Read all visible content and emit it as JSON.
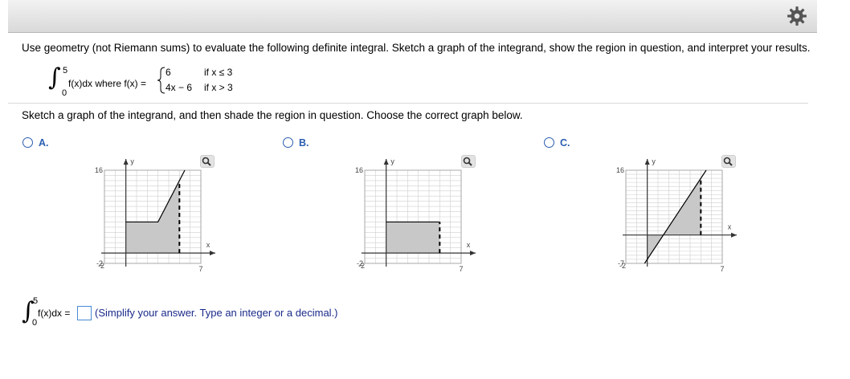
{
  "colors": {
    "accent": "#2a5db0",
    "shade": "#c8c8c8",
    "hint_text": "#1a2a8a",
    "input_border": "#4a8ad6"
  },
  "icons": {
    "settings": "gear-icon",
    "zoom": "magnifier-icon"
  },
  "question": {
    "instruction": "Use geometry (not Riemann sums) to evaluate the following definite integral. Sketch a graph of the integrand, show the region in question, and interpret your results.",
    "integral_upper": "5",
    "integral_lower": "0",
    "integrand_text": "f(x)dx where f(x) =",
    "piece1_expr": "6",
    "piece1_cond": "if x ≤ 3",
    "piece2_expr": "4x − 6",
    "piece2_cond": "if x > 3"
  },
  "prompt": "Sketch a graph of the integrand, and then shade the region in question. Choose the correct graph below.",
  "choices": [
    {
      "label": "A.",
      "y_max": "16",
      "y_min": "-2",
      "x_min": "-2",
      "x_max": "7",
      "x_axis": "x",
      "y_axis": "y"
    },
    {
      "label": "B.",
      "y_max": "16",
      "y_min": "-2",
      "x_min": "-2",
      "x_max": "7",
      "x_axis": "x",
      "y_axis": "y"
    },
    {
      "label": "C.",
      "y_max": "16",
      "y_min": "-7",
      "x_min": "-2",
      "x_max": "7",
      "x_axis": "x",
      "y_axis": "y"
    }
  ],
  "chart_data": [
    {
      "type": "line",
      "name": "A.",
      "xlim": [
        -2,
        7
      ],
      "ylim": [
        -2,
        16
      ],
      "grid": true,
      "line": [
        [
          0,
          6
        ],
        [
          3,
          6
        ],
        [
          5,
          14
        ],
        [
          5.5,
          16
        ]
      ],
      "shaded_region": {
        "x_from": 0,
        "x_to": 5,
        "under": "f(x)"
      },
      "dashed_x": 5
    },
    {
      "type": "line",
      "name": "B.",
      "xlim": [
        -2,
        7
      ],
      "ylim": [
        -2,
        16
      ],
      "grid": true,
      "line": [
        [
          0,
          6
        ],
        [
          5,
          6
        ]
      ],
      "shaded_region": {
        "x_from": 0,
        "x_to": 5,
        "under": "6"
      },
      "dashed_x": 5
    },
    {
      "type": "line",
      "name": "C.",
      "xlim": [
        -2,
        7
      ],
      "ylim": [
        -7,
        16
      ],
      "grid": true,
      "line": [
        [
          -0.25,
          -7
        ],
        [
          5.5,
          16
        ]
      ],
      "shaded_region": {
        "x_from": 0,
        "x_to": 5,
        "under": "4x-6"
      },
      "dashed_x": 5
    }
  ],
  "answer": {
    "upper": "5",
    "lower": "0",
    "lhs": "f(x)dx =",
    "value": "",
    "hint": "(Simplify your answer. Type an integer or a decimal.)"
  }
}
